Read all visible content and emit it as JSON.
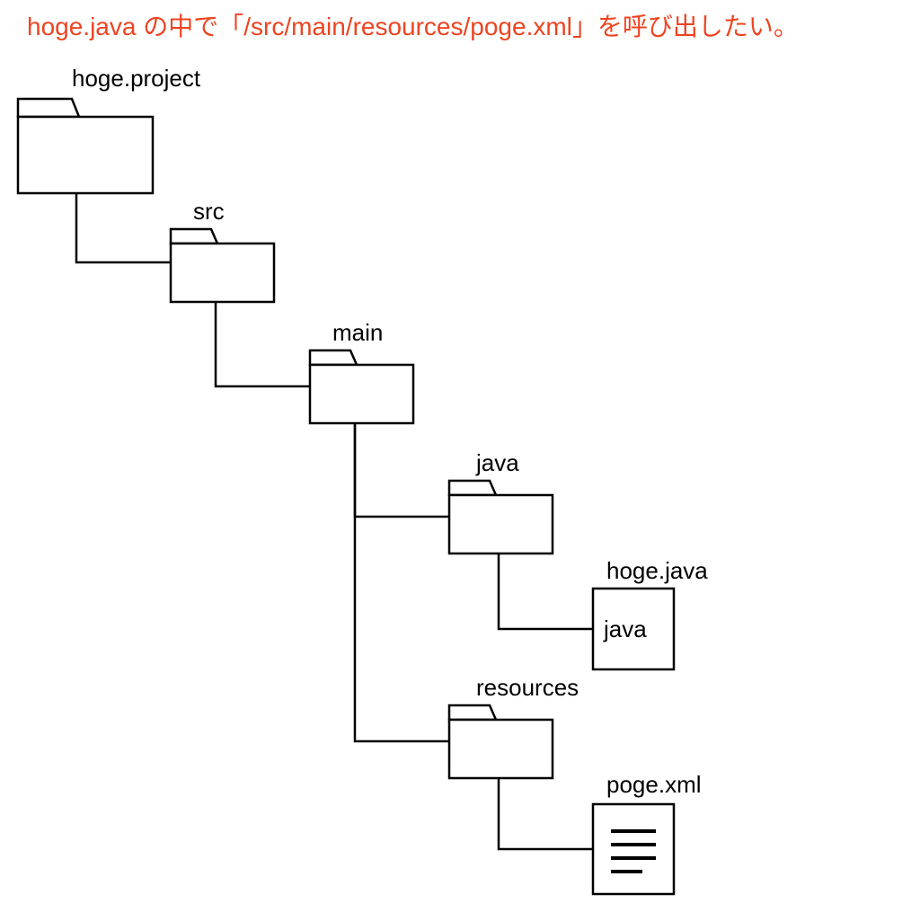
{
  "title": "hoge.java の中で「/src/main/resources/poge.xml」を呼び出したい。",
  "nodes": {
    "project": {
      "label": "hoge.project"
    },
    "src": {
      "label": "src"
    },
    "main": {
      "label": "main"
    },
    "java": {
      "label": "java"
    },
    "hogejava": {
      "label": "hoge.java",
      "box": "java"
    },
    "resources": {
      "label": "resources"
    },
    "pogexml": {
      "label": "poge.xml"
    }
  }
}
